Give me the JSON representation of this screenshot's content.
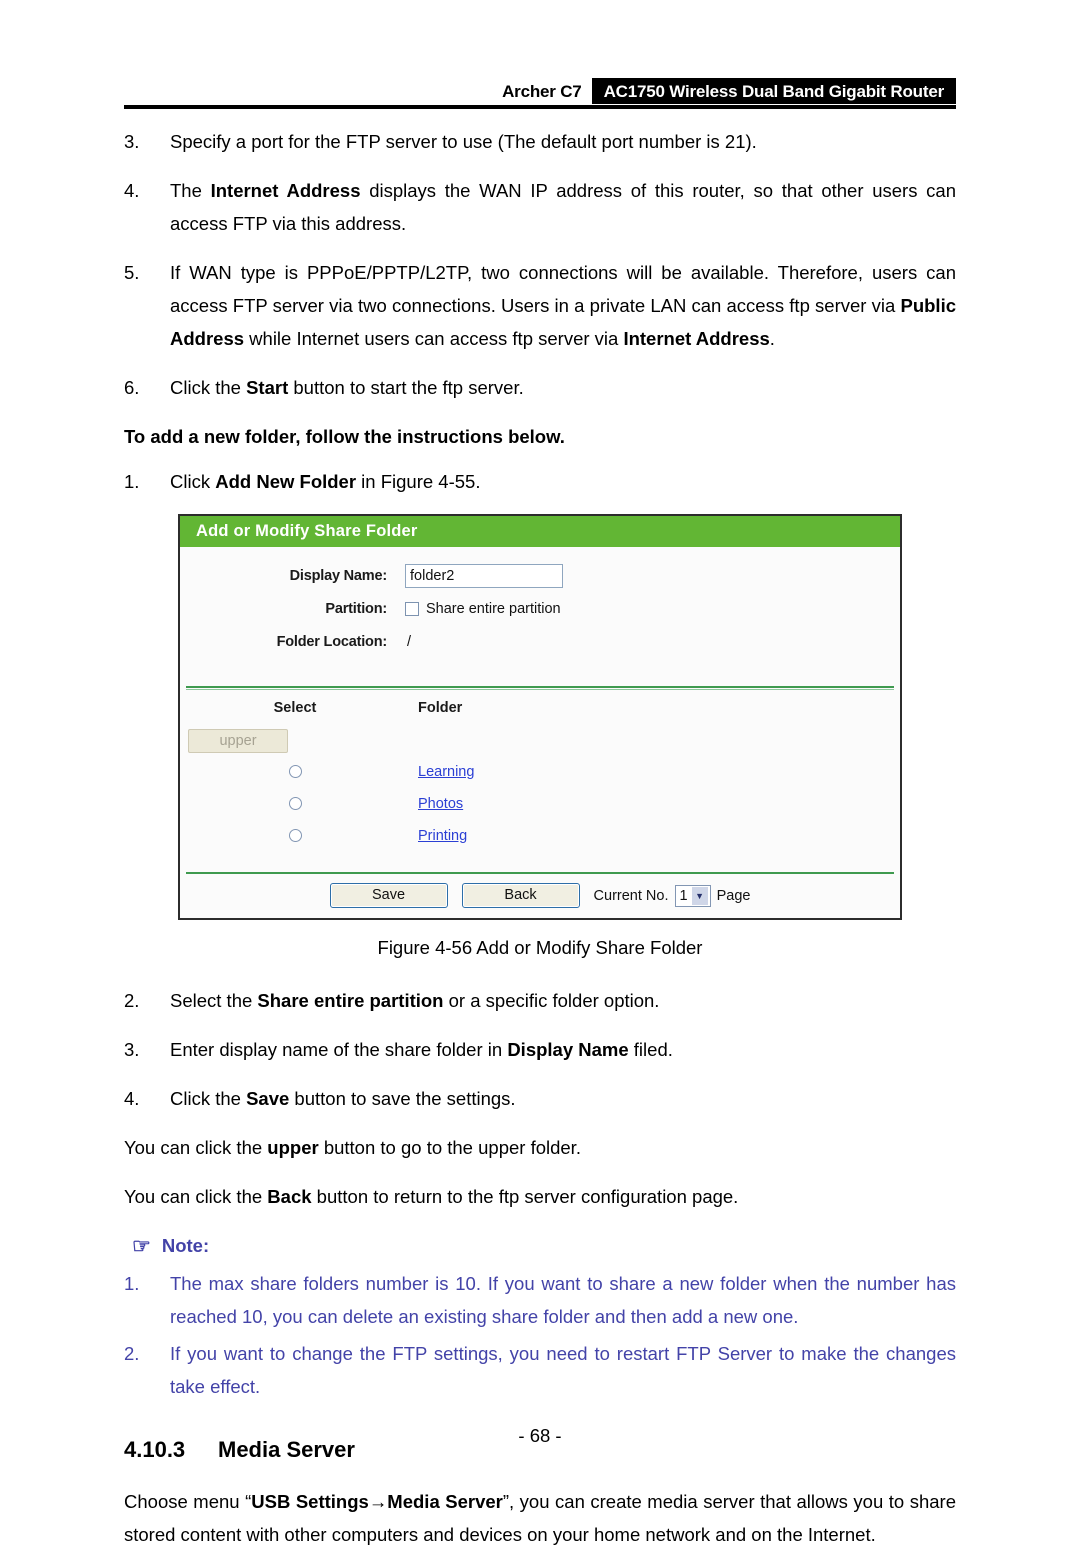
{
  "header": {
    "model": "Archer C7",
    "product": "AC1750 Wireless Dual Band Gigabit Router"
  },
  "steps_top": [
    {
      "num": "3.",
      "parts": [
        {
          "t": "Specify a port for the FTP server to use (The default port number is 21).",
          "b": false
        }
      ]
    },
    {
      "num": "4.",
      "parts": [
        {
          "t": "The ",
          "b": false
        },
        {
          "t": "Internet Address",
          "b": true
        },
        {
          "t": " displays the WAN IP address of this router, so that other users can access FTP via this address.",
          "b": false
        }
      ]
    },
    {
      "num": "5.",
      "parts": [
        {
          "t": "If WAN type is PPPoE/PPTP/L2TP, two connections will be available. Therefore, users can access FTP server via two connections. Users in a private LAN can access ftp server via ",
          "b": false
        },
        {
          "t": "Public Address",
          "b": true
        },
        {
          "t": " while Internet users can access ftp server via ",
          "b": false
        },
        {
          "t": "Internet Address",
          "b": true
        },
        {
          "t": ".",
          "b": false
        }
      ]
    },
    {
      "num": "6.",
      "parts": [
        {
          "t": "Click the ",
          "b": false
        },
        {
          "t": "Start",
          "b": true
        },
        {
          "t": " button to start the ftp server.",
          "b": false
        }
      ]
    }
  ],
  "lead_bold": "To add a new folder, follow the instructions below.",
  "step_one": {
    "num": "1.",
    "parts": [
      {
        "t": "Click ",
        "b": false
      },
      {
        "t": "Add New Folder",
        "b": true
      },
      {
        "t": " in Figure 4-55.",
        "b": false
      }
    ]
  },
  "figure": {
    "panel_title": "Add or Modify Share Folder",
    "fields": {
      "display_name_label": "Display Name:",
      "display_name_value": "folder2",
      "partition_label": "Partition:",
      "share_entire_partition_label": "Share entire partition",
      "folder_location_label": "Folder Location:",
      "folder_location_value": "/"
    },
    "table": {
      "col_select": "Select",
      "col_folder": "Folder",
      "upper_button": "upper",
      "rows": [
        {
          "folder": "Learning"
        },
        {
          "folder": "Photos"
        },
        {
          "folder": "Printing"
        }
      ]
    },
    "footer": {
      "save": "Save",
      "back": "Back",
      "current_no_label": "Current No.",
      "page_value": "1",
      "page_label": "Page"
    },
    "caption": "Figure 4-56 Add or Modify Share Folder",
    "colors": {
      "title_bar_green": "#62b634",
      "separator_green": "#3f9a4f",
      "link_blue": "#2b3fd4"
    }
  },
  "steps_bottom": [
    {
      "num": "2.",
      "parts": [
        {
          "t": "Select the ",
          "b": false
        },
        {
          "t": "Share entire partition",
          "b": true
        },
        {
          "t": " or a specific folder option.",
          "b": false
        }
      ]
    },
    {
      "num": "3.",
      "parts": [
        {
          "t": "Enter display name of the share folder in ",
          "b": false
        },
        {
          "t": "Display Name",
          "b": true
        },
        {
          "t": " filed.",
          "b": false
        }
      ]
    },
    {
      "num": "4.",
      "parts": [
        {
          "t": "Click the ",
          "b": false
        },
        {
          "t": "Save",
          "b": true
        },
        {
          "t": " button to save the settings.",
          "b": false
        }
      ]
    }
  ],
  "paragraphs": [
    {
      "parts": [
        {
          "t": "You can click the ",
          "b": false
        },
        {
          "t": "upper",
          "b": true
        },
        {
          "t": " button to go to the upper folder.",
          "b": false
        }
      ]
    },
    {
      "parts": [
        {
          "t": "You can click the ",
          "b": false
        },
        {
          "t": "Back",
          "b": true
        },
        {
          "t": " button to return to the ftp server configuration page.",
          "b": false
        }
      ]
    }
  ],
  "note": {
    "icon": "pointing-hand-icon",
    "glyph": "☞",
    "title": "Note:",
    "color": "#4343a8",
    "items": [
      {
        "num": "1.",
        "parts": [
          {
            "t": "The max share folders number is 10. If you want to share a new folder when the number has reached 10, you can delete an existing share folder and then add a new one.",
            "b": false
          }
        ]
      },
      {
        "num": "2.",
        "parts": [
          {
            "t": "If you want to change the FTP settings, you need to restart FTP Server to make the changes take effect.",
            "b": false
          }
        ]
      }
    ]
  },
  "section": {
    "number": "4.10.3",
    "title": "Media Server",
    "body_parts": [
      {
        "t": "Choose menu “",
        "b": false
      },
      {
        "t": "USB Settings→Media Server",
        "b": true
      },
      {
        "t": "”, you can create media server that allows you to share stored content with other computers and devices on your home network and on the Internet.",
        "b": false
      }
    ]
  },
  "page_number": "- 68 -"
}
